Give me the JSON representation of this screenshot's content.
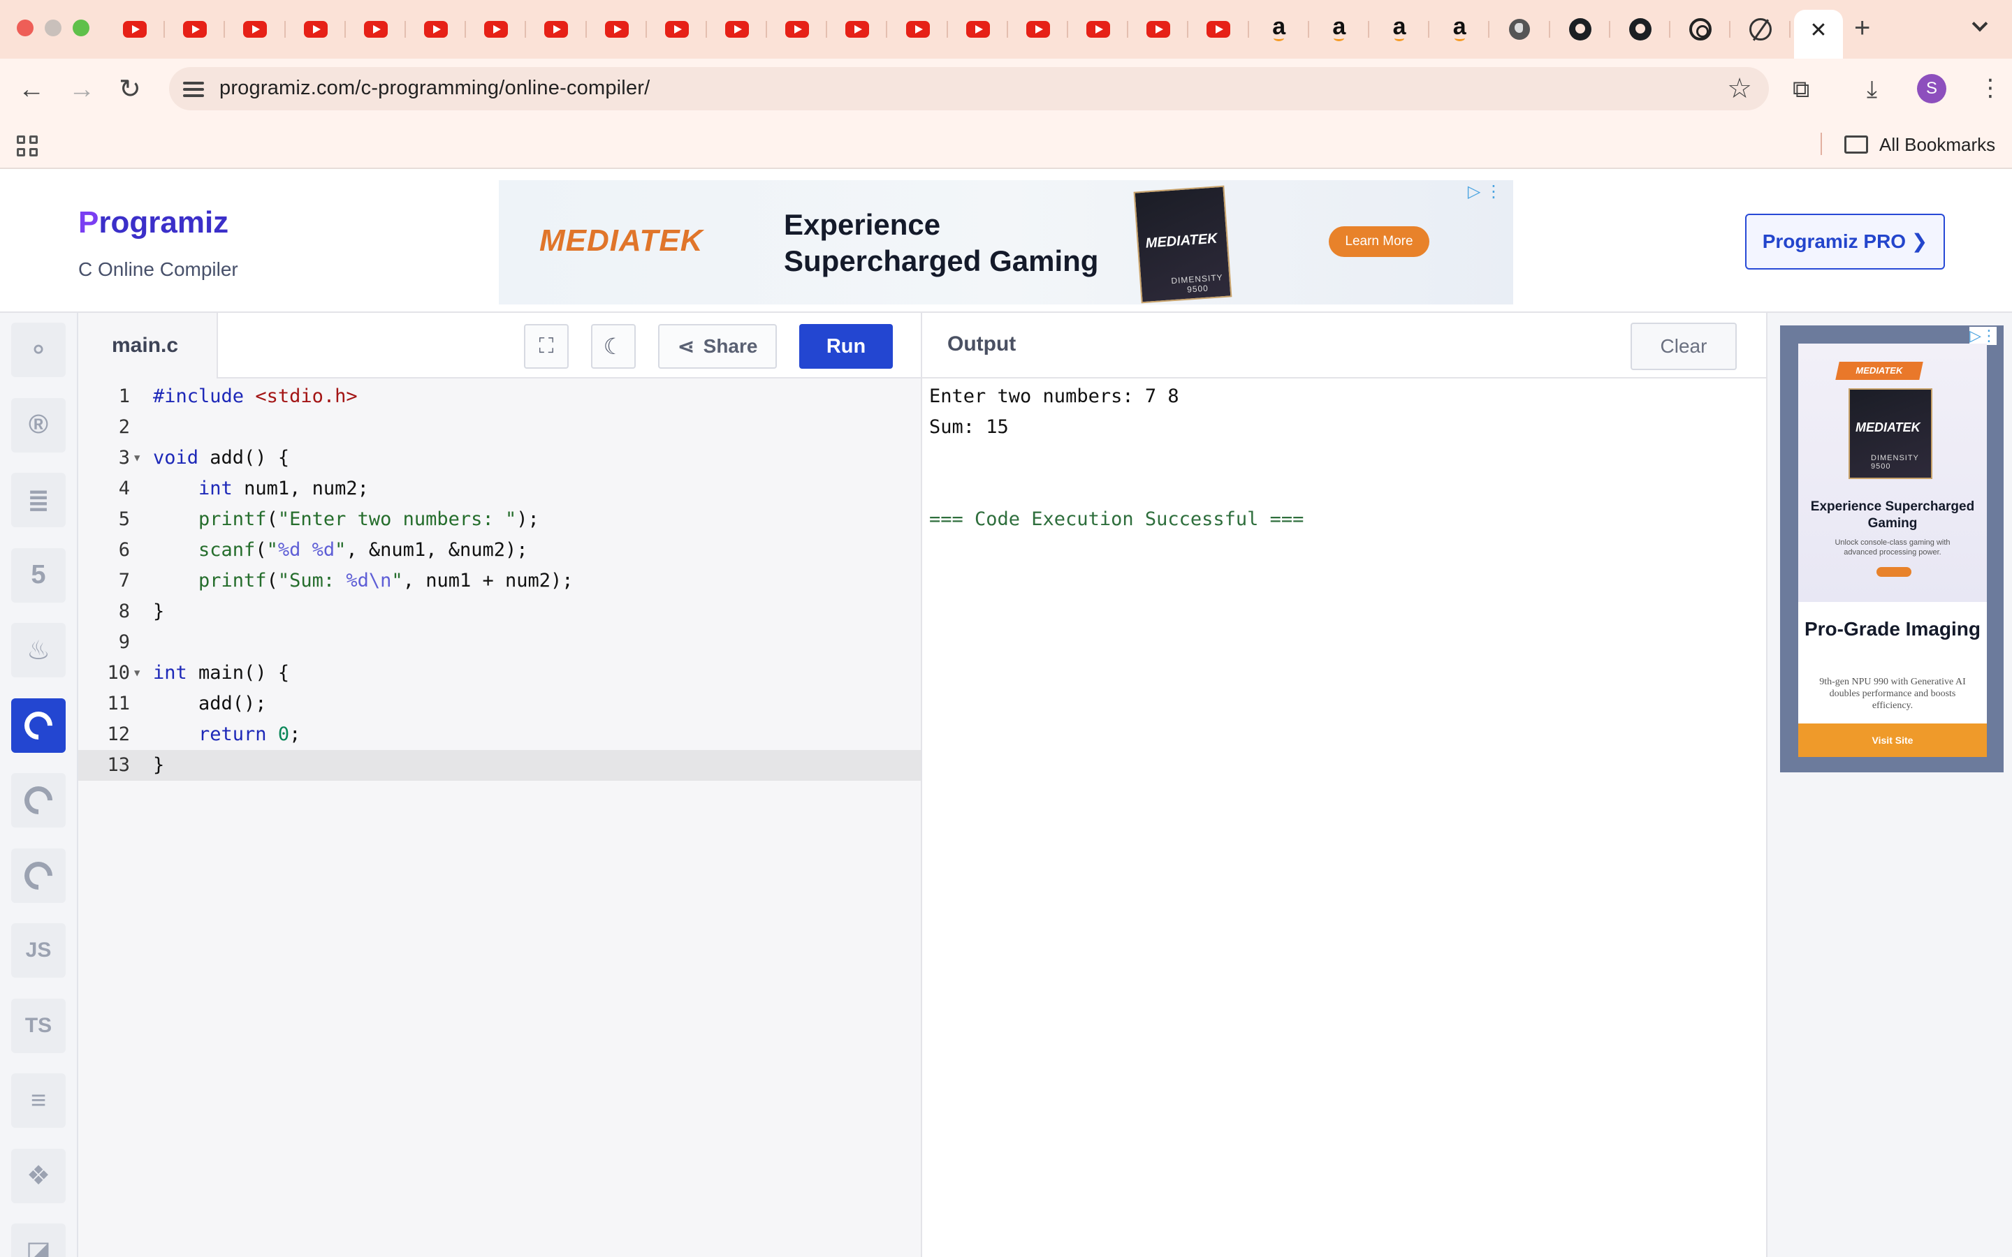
{
  "browser": {
    "tabs": [
      {
        "icon": "youtube-icon"
      },
      {
        "icon": "youtube-icon"
      },
      {
        "icon": "youtube-icon"
      },
      {
        "icon": "youtube-icon"
      },
      {
        "icon": "youtube-icon"
      },
      {
        "icon": "youtube-icon"
      },
      {
        "icon": "youtube-icon"
      },
      {
        "icon": "youtube-icon"
      },
      {
        "icon": "youtube-icon"
      },
      {
        "icon": "youtube-icon"
      },
      {
        "icon": "youtube-icon"
      },
      {
        "icon": "youtube-icon"
      },
      {
        "icon": "youtube-icon"
      },
      {
        "icon": "youtube-icon"
      },
      {
        "icon": "youtube-icon"
      },
      {
        "icon": "youtube-icon"
      },
      {
        "icon": "youtube-icon"
      },
      {
        "icon": "youtube-icon"
      },
      {
        "icon": "youtube-icon"
      },
      {
        "icon": "amazon-icon",
        "text": "a"
      },
      {
        "icon": "amazon-icon",
        "text": "a"
      },
      {
        "icon": "amazon-icon",
        "text": "a"
      },
      {
        "icon": "amazon-icon",
        "text": "a"
      },
      {
        "icon": "globe-icon"
      },
      {
        "icon": "github-icon"
      },
      {
        "icon": "github-icon"
      },
      {
        "icon": "chatgpt-icon"
      },
      {
        "icon": "perplexity-icon"
      }
    ],
    "active_tab_close": "✕",
    "new_tab": "+",
    "url": "programiz.com/c-programming/online-compiler/",
    "avatar_letter": "S",
    "bookmarks_label": "All Bookmarks"
  },
  "header": {
    "logo_first": "P",
    "logo_rest": "rogramiz",
    "subtitle": "C Online Compiler",
    "pro_button": "Programiz PRO ❯"
  },
  "banner_ad": {
    "brand": "MEDIATEK",
    "headline": "Experience Supercharged Gaming",
    "chip_brand": "MEDIATEK",
    "chip_model": "DIMENSITY 9500",
    "cta": "Learn More"
  },
  "languages": [
    {
      "name": "python",
      "icon": "python-icon"
    },
    {
      "name": "r",
      "icon": "r-icon"
    },
    {
      "name": "sql",
      "icon": "database-icon"
    },
    {
      "name": "html",
      "icon": "html5-icon"
    },
    {
      "name": "java",
      "icon": "java-icon"
    },
    {
      "name": "c",
      "icon": "c-icon",
      "active": true
    },
    {
      "name": "cpp",
      "icon": "cpp-icon"
    },
    {
      "name": "csharp",
      "icon": "csharp-icon"
    },
    {
      "name": "javascript",
      "label": "JS"
    },
    {
      "name": "typescript",
      "label": "TS"
    },
    {
      "name": "go",
      "icon": "stack-icon"
    },
    {
      "name": "swift",
      "icon": "swift-icon"
    },
    {
      "name": "rust",
      "icon": "rust-icon"
    }
  ],
  "editor": {
    "file_name": "main.c",
    "share_label": "Share",
    "run_label": "Run",
    "lines": [
      "#include <stdio.h>",
      "",
      "void add() {",
      "    int num1, num2;",
      "    printf(\"Enter two numbers: \");",
      "    scanf(\"%d %d\", &num1, &num2);",
      "    printf(\"Sum: %d\\n\", num1 + num2);",
      "}",
      "",
      "int main() {",
      "    add();",
      "    return 0;",
      "}"
    ],
    "current_line": 13
  },
  "output": {
    "title": "Output",
    "clear_label": "Clear",
    "lines": [
      "Enter two numbers: 7 8",
      "Sum: 15",
      "",
      "",
      "=== Code Execution Successful ==="
    ]
  },
  "side_ad": {
    "tag": "MEDIATEK",
    "chip_brand": "MEDIATEK",
    "chip_model": "DIMENSITY 9500",
    "headline": "Experience Supercharged Gaming",
    "small_text": "Unlock console-class gaming with advanced processing power.",
    "title2": "Pro-Grade Imaging",
    "description": "9th-gen NPU 990 with Generative AI doubles performance and boosts efficiency.",
    "cta": "Visit Site"
  },
  "colors": {
    "accent": "#2346d1",
    "tab_bar": "#fbe2d7",
    "success": "#2e6e3c"
  }
}
